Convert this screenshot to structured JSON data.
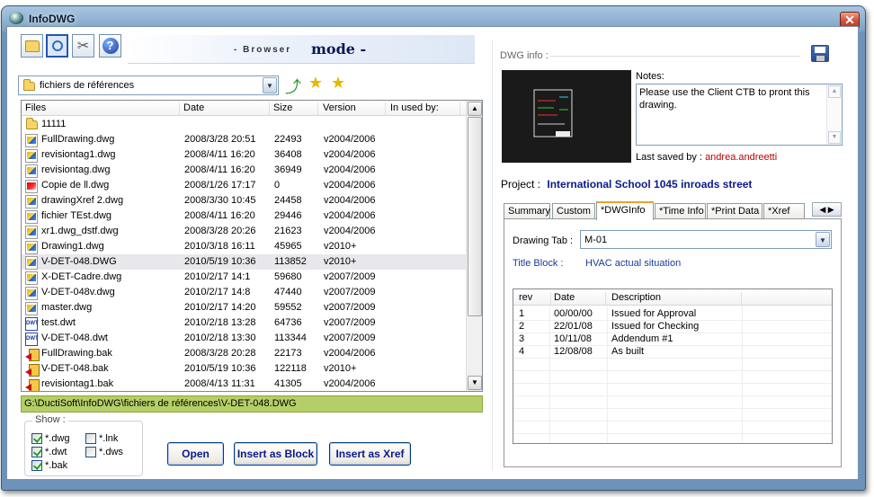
{
  "window": {
    "title": "InfoDWG",
    "close_label": "✕"
  },
  "toolbar": {
    "icons": [
      "open-folder-icon",
      "search-icon",
      "tools-icon",
      "help-icon"
    ],
    "mode_prefix": "- Browser",
    "mode_main": "mode -"
  },
  "folder_combo": {
    "value": "fichiers de références"
  },
  "nav_icons": [
    "up-folder-icon",
    "star-icon",
    "add-favorite-icon"
  ],
  "file_list": {
    "columns": [
      "Files",
      "Date",
      "Size",
      "Version",
      "In used by:"
    ],
    "rows": [
      {
        "name": "11111",
        "date": "",
        "size": "",
        "version": "",
        "icon": "folder"
      },
      {
        "name": "FullDrawing.dwg",
        "date": "2008/3/28 20:51",
        "size": "22493",
        "version": "v2004/2006",
        "icon": "dwg"
      },
      {
        "name": "revisiontag1.dwg",
        "date": "2008/4/11 16:20",
        "size": "36408",
        "version": "v2004/2006",
        "icon": "dwg"
      },
      {
        "name": "revisiontag.dwg",
        "date": "2008/4/11 16:20",
        "size": "36949",
        "version": "v2004/2006",
        "icon": "dwg"
      },
      {
        "name": "Copie de ll.dwg",
        "date": "2008/1/26 17:17",
        "size": "0",
        "version": "v2004/2006",
        "icon": "bad"
      },
      {
        "name": "drawingXref 2.dwg",
        "date": "2008/3/30 10:45",
        "size": "24458",
        "version": "v2004/2006",
        "icon": "dwg"
      },
      {
        "name": "fichier TEst.dwg",
        "date": "2008/4/11 16:20",
        "size": "29446",
        "version": "v2004/2006",
        "icon": "dwg"
      },
      {
        "name": "xr1.dwg_dstf.dwg",
        "date": "2008/3/28 20:26",
        "size": "21623",
        "version": "v2004/2006",
        "icon": "dwg"
      },
      {
        "name": "Drawing1.dwg",
        "date": "2010/3/18 16:11",
        "size": "45965",
        "version": "v2010+",
        "icon": "dwg"
      },
      {
        "name": "V-DET-048.DWG",
        "date": "2010/5/19 10:36",
        "size": "113852",
        "version": "v2010+",
        "icon": "dwg",
        "selected": true
      },
      {
        "name": "X-DET-Cadre.dwg",
        "date": "2010/2/17 14:1",
        "size": "59680",
        "version": "v2007/2009",
        "icon": "dwg"
      },
      {
        "name": "V-DET-048v.dwg",
        "date": "2010/2/17 14:8",
        "size": "47440",
        "version": "v2007/2009",
        "icon": "dwg"
      },
      {
        "name": "master.dwg",
        "date": "2010/2/17 14:20",
        "size": "59552",
        "version": "v2007/2009",
        "icon": "dwg"
      },
      {
        "name": "test.dwt",
        "date": "2010/2/18 13:28",
        "size": "64736",
        "version": "v2007/2009",
        "icon": "dwt"
      },
      {
        "name": "V-DET-048.dwt",
        "date": "2010/2/18 13:30",
        "size": "113344",
        "version": "v2007/2009",
        "icon": "dwt"
      },
      {
        "name": "FullDrawing.bak",
        "date": "2008/3/28 20:28",
        "size": "22173",
        "version": "v2004/2006",
        "icon": "bak"
      },
      {
        "name": "V-DET-048.bak",
        "date": "2010/5/19 10:36",
        "size": "122118",
        "version": "v2010+",
        "icon": "bak"
      },
      {
        "name": "revisiontag1.bak",
        "date": "2008/4/13 11:31",
        "size": "41305",
        "version": "v2004/2006",
        "icon": "bak"
      }
    ]
  },
  "path": "G:\\DuctiSoft\\InfoDWG\\fichiers de références\\V-DET-048.DWG",
  "show_group": {
    "label": "Show :",
    "options": [
      {
        "label": "*.dwg",
        "checked": true
      },
      {
        "label": "*.dwt",
        "checked": true
      },
      {
        "label": "*.bak",
        "checked": true
      },
      {
        "label": "*.lnk",
        "checked": false
      },
      {
        "label": "*.dws",
        "checked": false
      }
    ]
  },
  "buttons": {
    "open": "Open",
    "insert_block": "Insert as Block",
    "insert_xref": "Insert as Xref"
  },
  "dwg_info": {
    "label": "DWG info :",
    "notes_label": "Notes:",
    "notes_text": "Please use the Client CTB to pront this drawing.",
    "last_saved_label": "Last saved by :",
    "last_saved_user": "andrea.andreetti",
    "project_label": "Project :",
    "project_name": "International School 1045 inroads street"
  },
  "tabs": [
    "Summary",
    "Custom",
    "*DWGInfo",
    "*Time Info",
    "*Print Data",
    "*Xref"
  ],
  "dwginfo": {
    "drawing_tab_label": "Drawing Tab :",
    "drawing_tab_value": "M-01",
    "title_block_label": "Title Block :",
    "title_block_value": "HVAC actual situation",
    "rev_columns": [
      "rev",
      "Date",
      "Description"
    ],
    "revisions": [
      {
        "rev": "1",
        "date": "00/00/00",
        "desc": "Issued for Approval"
      },
      {
        "rev": "2",
        "date": "22/01/08",
        "desc": "Issued for Checking"
      },
      {
        "rev": "3",
        "date": "10/11/08",
        "desc": "Addendum #1"
      },
      {
        "rev": "4",
        "date": "12/08/08",
        "desc": "As built"
      }
    ]
  },
  "colors": {
    "path_bar": "#b5cf68",
    "project": "#0b1a8a",
    "user": "#c00000",
    "title_block": "#1a3a9a"
  }
}
